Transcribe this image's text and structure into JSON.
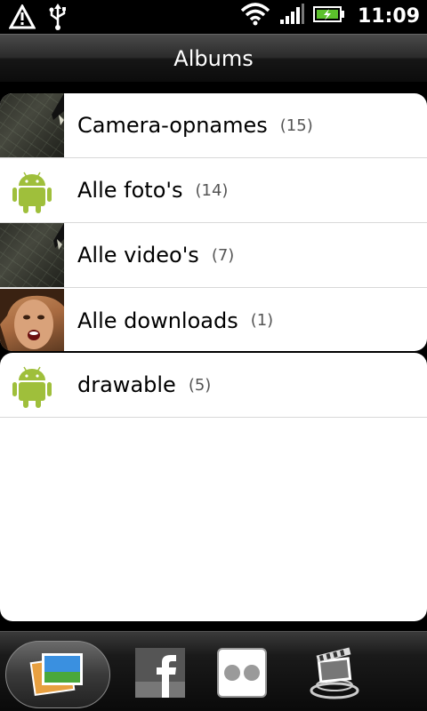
{
  "status_bar": {
    "time": "11:09"
  },
  "header": {
    "title": "Albums"
  },
  "albums": [
    {
      "label": "Camera-opnames",
      "count": "(15)"
    },
    {
      "label": "Alle foto's",
      "count": "(14)"
    },
    {
      "label": "Alle video's",
      "count": "(7)"
    },
    {
      "label": "Alle downloads",
      "count": "(1)"
    },
    {
      "label": "drawable",
      "count": "(5)"
    }
  ],
  "tabs": [
    {
      "icon": "albums-icon",
      "selected": true
    },
    {
      "icon": "facebook-icon",
      "selected": false
    },
    {
      "icon": "flickr-icon",
      "selected": false
    },
    {
      "icon": "video-player-icon",
      "selected": false
    }
  ],
  "colors": {
    "android_green": "#9fbf3b",
    "accent": "#000000"
  }
}
